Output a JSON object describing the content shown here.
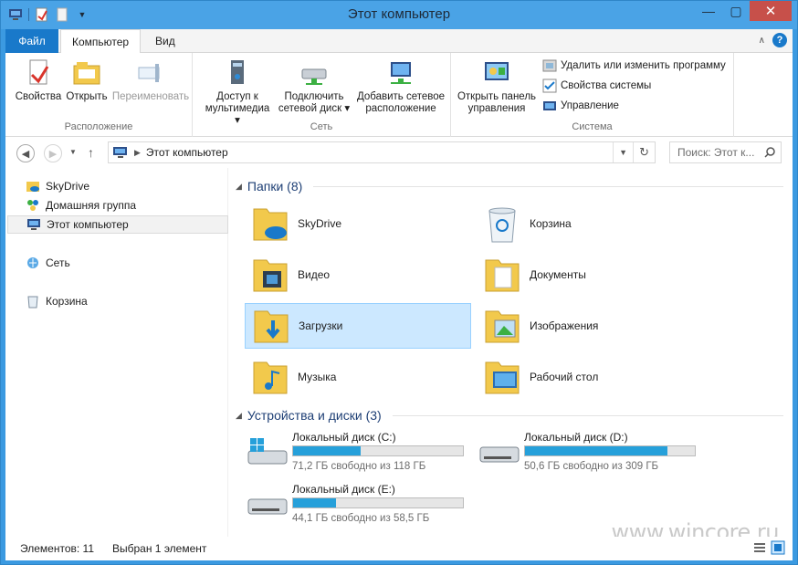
{
  "window": {
    "title": "Этот компьютер"
  },
  "ribbon_tabs": {
    "file": "Файл",
    "computer": "Компьютер",
    "view": "Вид"
  },
  "ribbon": {
    "groups": [
      {
        "label": "Расположение"
      },
      {
        "label": "Сеть"
      },
      {
        "label": "Система"
      }
    ],
    "properties": "Свойства",
    "open": "Открыть",
    "rename": "Переименовать",
    "media_access_1": "Доступ к",
    "media_access_2": "мультимедиа",
    "map_drive_1": "Подключить",
    "map_drive_2": "сетевой диск",
    "add_location_1": "Добавить сетевое",
    "add_location_2": "расположение",
    "control_panel_1": "Открыть панель",
    "control_panel_2": "управления",
    "uninstall": "Удалить или изменить программу",
    "system_props": "Свойства системы",
    "manage": "Управление"
  },
  "address": {
    "path": "Этот компьютер",
    "search_placeholder": "Поиск: Этот к..."
  },
  "nav": {
    "items": [
      {
        "label": "SkyDrive"
      },
      {
        "label": "Домашняя группа"
      },
      {
        "label": "Этот компьютер"
      },
      {
        "label": "Сеть"
      },
      {
        "label": "Корзина"
      }
    ]
  },
  "folders": {
    "header": "Папки (8)",
    "items": [
      {
        "label": "SkyDrive"
      },
      {
        "label": "Корзина"
      },
      {
        "label": "Видео"
      },
      {
        "label": "Документы"
      },
      {
        "label": "Загрузки"
      },
      {
        "label": "Изображения"
      },
      {
        "label": "Музыка"
      },
      {
        "label": "Рабочий стол"
      }
    ]
  },
  "drives": {
    "header": "Устройства и диски (3)",
    "items": [
      {
        "label": "Локальный диск (C:)",
        "free": "71,2 ГБ свободно из 118 ГБ",
        "used_fraction": 0.4
      },
      {
        "label": "Локальный диск (D:)",
        "free": "50,6 ГБ свободно из 309 ГБ",
        "used_fraction": 0.84
      },
      {
        "label": "Локальный диск (E:)",
        "free": "44,1 ГБ свободно из 58,5 ГБ",
        "used_fraction": 0.25
      }
    ]
  },
  "status": {
    "count": "Элементов: 11",
    "selected": "Выбран 1 элемент"
  },
  "watermark": "www.wincore.ru",
  "colors": {
    "accent": "#1979ca",
    "selection": "#cce8ff",
    "drive_bar": "#26a0da",
    "folder": "#f2c94c"
  }
}
